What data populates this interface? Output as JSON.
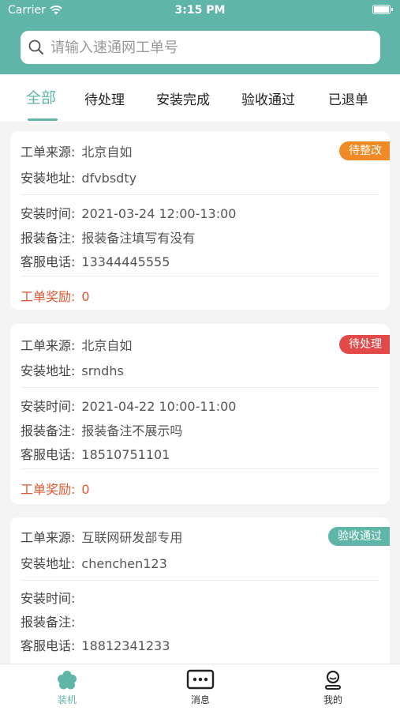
{
  "status_bar": {
    "carrier": "Carrier",
    "time": "3:15 PM"
  },
  "search": {
    "placeholder": "请输入速通网工单号"
  },
  "tabs": [
    {
      "label": "全部",
      "active": true
    },
    {
      "label": "待处理"
    },
    {
      "label": "安装完成"
    },
    {
      "label": "验收通过"
    },
    {
      "label": "已退单"
    }
  ],
  "colors": {
    "accent": "#5fb5a8",
    "orange": "#f08a24",
    "red": "#e24a4a",
    "teal_badge": "#5fb5a8",
    "reward": "#e0552f"
  },
  "labels": {
    "source": "工单来源:",
    "address": "安装地址:",
    "install_time": "安装时间:",
    "remark": "报装备注:",
    "phone": "客服电话:",
    "reward": "工单奖励:"
  },
  "orders": [
    {
      "source": "北京自如",
      "address": "dfvbsdty",
      "install_time": "2021-03-24 12:00-13:00",
      "remark": "报装备注填写有没有",
      "phone": "13344445555",
      "reward": "0",
      "status": "待整改"
    },
    {
      "source": "北京自如",
      "address": "srndhs",
      "install_time": "2021-04-22 10:00-11:00",
      "remark": "报装备注不展示吗",
      "phone": "18510751101",
      "reward": "0",
      "status": "待处理"
    },
    {
      "source": "互联网研发部专用",
      "address": "chenchen123",
      "install_time": "",
      "remark": "",
      "phone": "18812341233",
      "status": "验收通过"
    }
  ],
  "tabbar": [
    {
      "label": "装机",
      "icon": "flower-icon",
      "active": true
    },
    {
      "label": "消息",
      "icon": "message-icon"
    },
    {
      "label": "我的",
      "icon": "user-icon"
    }
  ]
}
